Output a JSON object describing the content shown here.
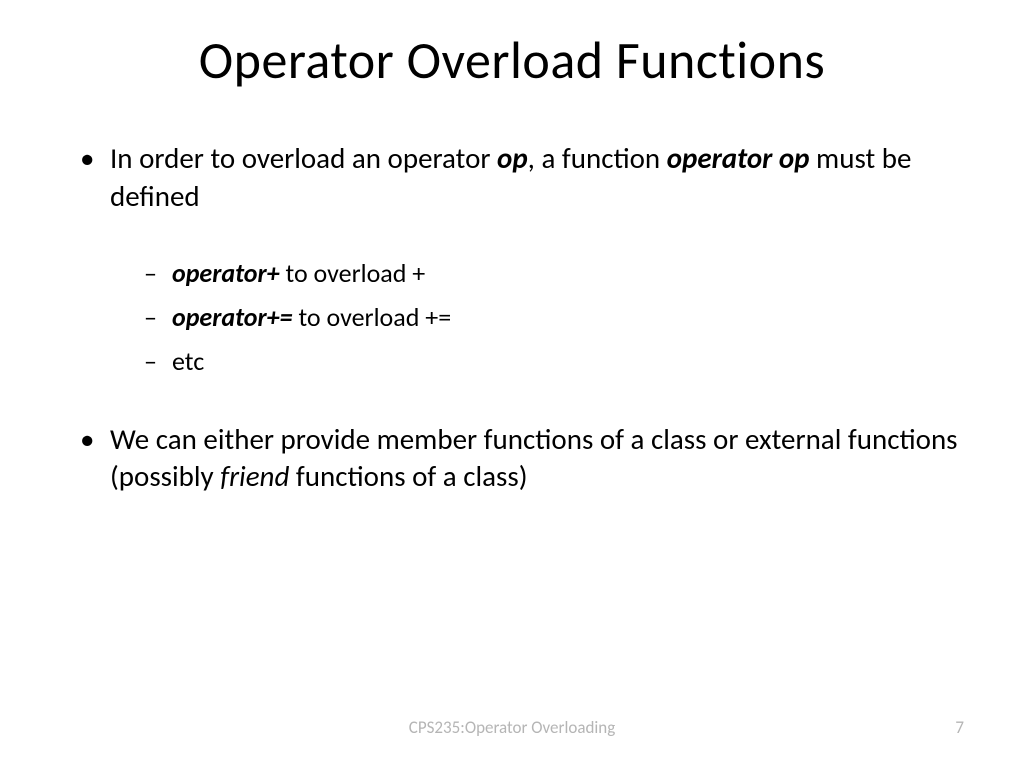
{
  "title": "Operator Overload Functions",
  "bullets": {
    "b1_pre": "In order to overload an operator ",
    "b1_op": "op",
    "b1_mid": ", a function ",
    "b1_func": "operator op",
    "b1_post": " must be defined",
    "sub1_bold": "operator+",
    "sub1_rest": "  to overload +",
    "sub2_bold": "operator+=",
    "sub2_rest": "  to overload +=",
    "sub3": "etc",
    "b2_pre": "We can either provide member functions of a class or external functions (possibly ",
    "b2_it": "friend",
    "b2_post": " functions of a class)"
  },
  "footer": {
    "center": "CPS235:Operator Overloading",
    "page": "7"
  }
}
